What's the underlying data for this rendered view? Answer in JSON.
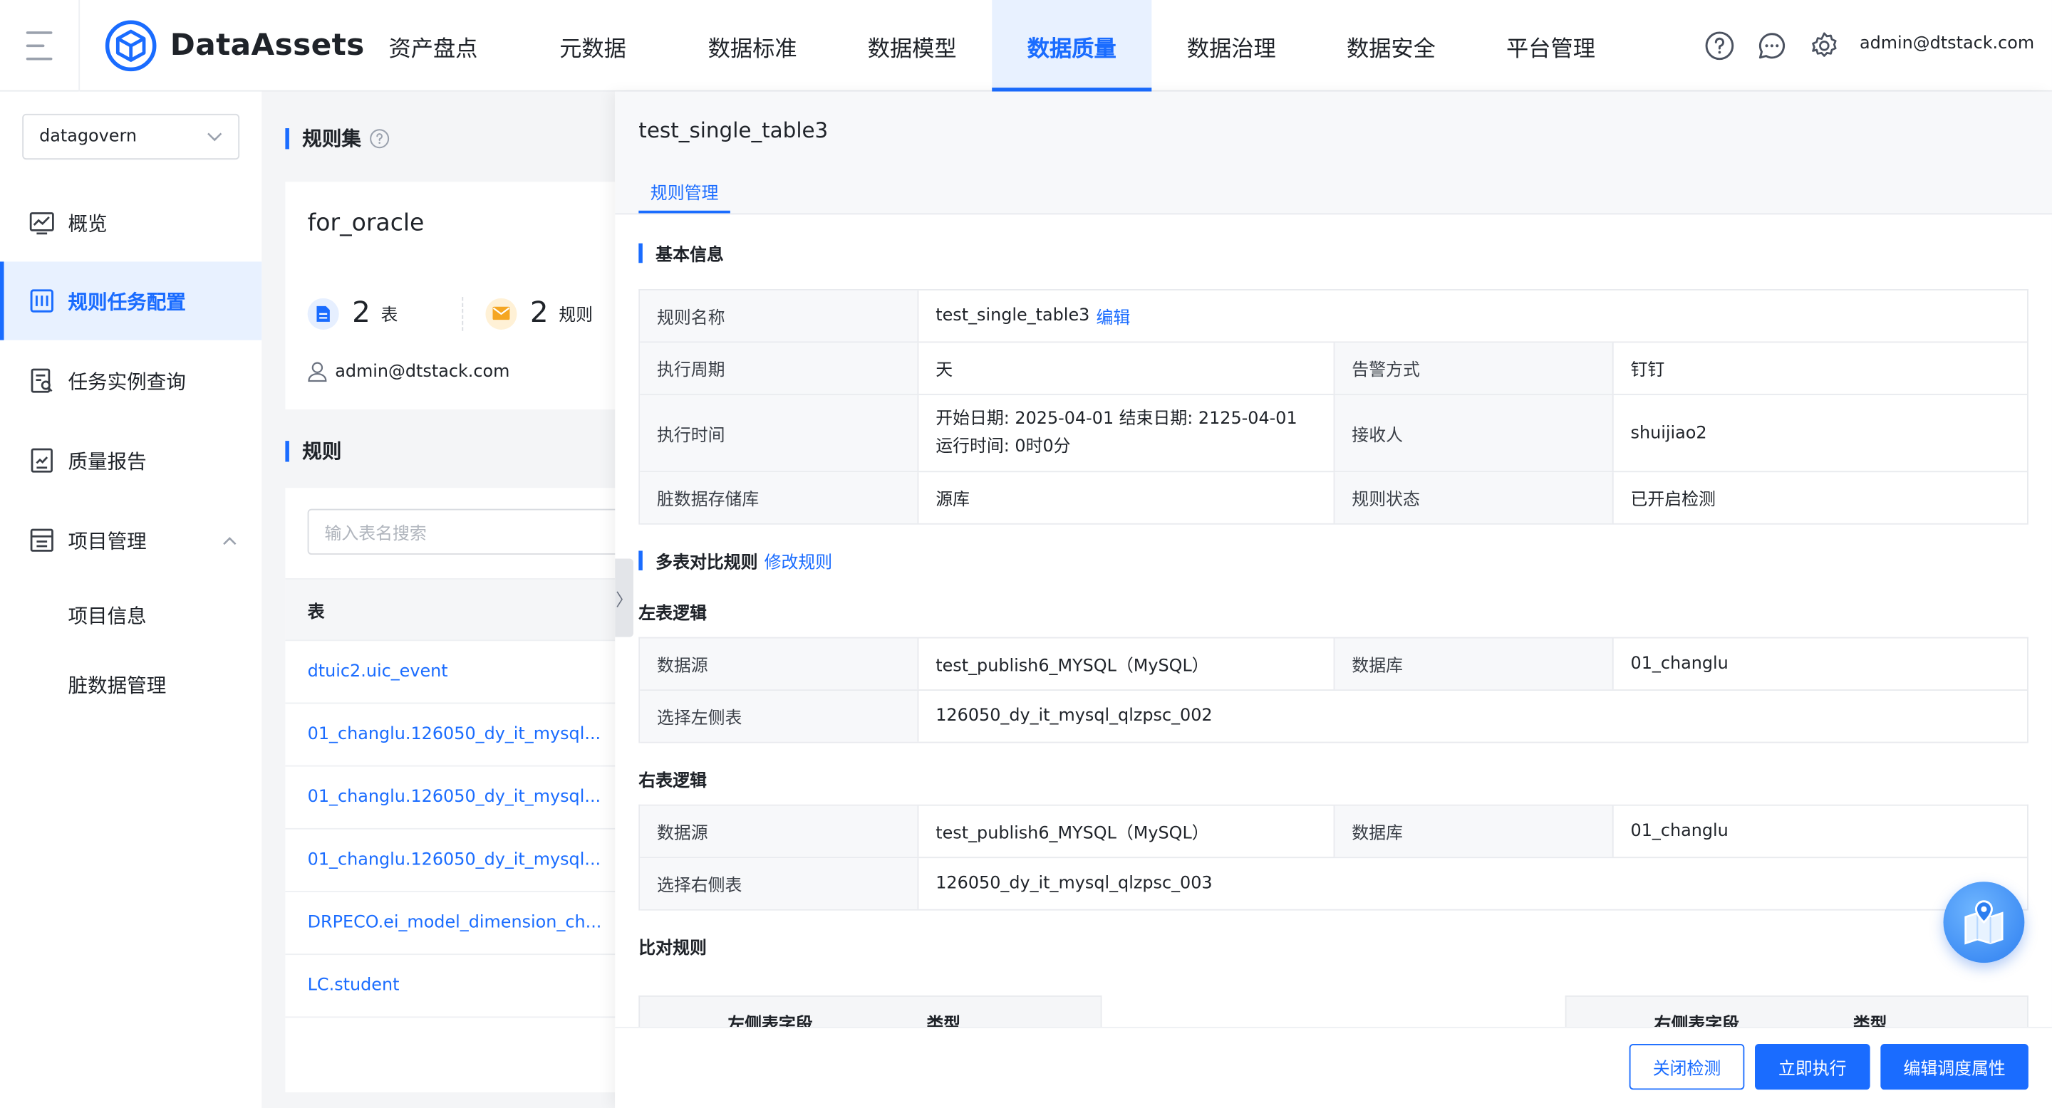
{
  "header": {
    "brand": "DataAssets",
    "nav": [
      {
        "label": "资产盘点",
        "active": false
      },
      {
        "label": "元数据",
        "active": false
      },
      {
        "label": "数据标准",
        "active": false
      },
      {
        "label": "数据模型",
        "active": false
      },
      {
        "label": "数据质量",
        "active": true
      },
      {
        "label": "数据治理",
        "active": false
      },
      {
        "label": "数据安全",
        "active": false
      },
      {
        "label": "平台管理",
        "active": false
      }
    ],
    "icons": [
      "help-icon",
      "message-icon",
      "settings-icon"
    ],
    "user": "admin@dtstack.com"
  },
  "sidebar": {
    "project": "datagovern",
    "items": [
      {
        "label": "概览",
        "icon": "overview-icon"
      },
      {
        "label": "规则任务配置",
        "icon": "rule-task-icon"
      },
      {
        "label": "任务实例查询",
        "icon": "instance-query-icon"
      },
      {
        "label": "质量报告",
        "icon": "report-icon"
      },
      {
        "label": "项目管理",
        "icon": "project-icon"
      }
    ],
    "sub_items": [
      "项目信息",
      "脏数据管理"
    ]
  },
  "ruleset": {
    "section_title": "规则集",
    "name": "for_oracle",
    "table_count": "2",
    "table_unit": "表",
    "rule_count": "2",
    "rule_unit": "规则",
    "owner": "admin@dtstack.com"
  },
  "rules": {
    "section_title": "规则",
    "search_placeholder": "输入表名搜索",
    "column": "表",
    "tables": [
      "dtuic2.uic_event",
      "01_changlu.126050_dy_it_mysql...",
      "01_changlu.126050_dy_it_mysql...",
      "01_changlu.126050_dy_it_mysql...",
      "DRPECO.ei_model_dimension_ch...",
      "LC.student"
    ]
  },
  "drawer": {
    "title": "test_single_table3",
    "tab": "规则管理",
    "basic": {
      "section": "基本信息",
      "rule_name_label": "规则名称",
      "rule_name": "test_single_table3",
      "edit": "编辑",
      "cycle_label": "执行周期",
      "cycle": "天",
      "alert_label": "告警方式",
      "alert": "钉钉",
      "time_label": "执行时间",
      "time_line1": "开始日期: 2025-04-01 结束日期: 2125-04-01",
      "time_line2": "运行时间: 0时0分",
      "receiver_label": "接收人",
      "receiver": "shuijiao2",
      "dirty_label": "脏数据存储库",
      "dirty": "源库",
      "status_label": "规则状态",
      "status": "已开启检测"
    },
    "multi": {
      "section": "多表对比规则",
      "modify": "修改规则",
      "left_title": "左表逻辑",
      "right_title": "右表逻辑",
      "ds_label": "数据源",
      "db_label": "数据库",
      "left_ds": "test_publish6_MYSQL（MySQL）",
      "left_db": "01_changlu",
      "left_tbl_label": "选择左侧表",
      "left_tbl": "126050_dy_it_mysql_qlzpsc_002",
      "right_ds": "test_publish6_MYSQL（MySQL）",
      "right_db": "01_changlu",
      "right_tbl_label": "选择右侧表",
      "right_tbl": "126050_dy_it_mysql_qlzpsc_003",
      "compare_title": "比对规则",
      "left_field_col": "左侧表字段",
      "type_col": "类型",
      "right_field_col": "右侧表字段"
    },
    "buttons": {
      "close": "关闭检测",
      "run": "立即执行",
      "edit_schedule": "编辑调度属性"
    }
  },
  "colors": {
    "accent": "#1a6cff",
    "table_badge": "#e6efff",
    "rule_badge": "#fff1d6"
  }
}
